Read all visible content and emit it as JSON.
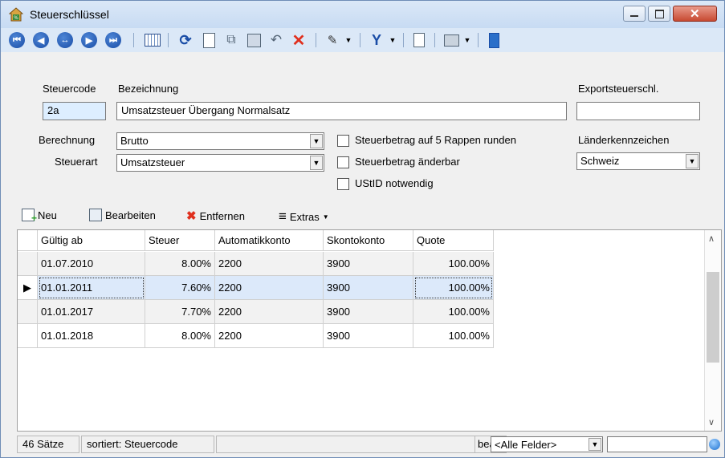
{
  "window": {
    "title": "Steuerschlüssel"
  },
  "titlebar": {
    "minimize": "minimize",
    "maximize": "maximize",
    "close": "close"
  },
  "toolbar": {
    "nav": [
      "first",
      "prev",
      "search",
      "next",
      "last"
    ],
    "icons": [
      "table-icon",
      "refresh-icon",
      "new-doc-icon",
      "copy-icon",
      "save-icon",
      "undo-icon",
      "delete-icon",
      "pin-icon",
      "filter-icon",
      "dataset-icon",
      "print-icon",
      "book-icon"
    ]
  },
  "form": {
    "steuercode_label": "Steuercode",
    "bezeichnung_label": "Bezeichnung",
    "export_label": "Exportsteuerschl.",
    "steuercode_value": "2a",
    "bezeichnung_value": "Umsatzsteuer Übergang Normalsatz",
    "export_value": "",
    "berechnung_label": "Berechnung",
    "berechnung_value": "Brutto",
    "steuerart_label": "Steuerart",
    "steuerart_value": "Umsatzsteuer",
    "cb_round": "Steuerbetrag auf 5 Rappen runden",
    "cb_edit": "Steuerbetrag änderbar",
    "cb_ustid": "UStID notwendig",
    "laender_label": "Länderkennzeichen",
    "laender_value": "Schweiz"
  },
  "subtoolbar": {
    "neu": "Neu",
    "bearbeiten": "Bearbeiten",
    "entfernen": "Entfernen",
    "extras": "Extras"
  },
  "grid": {
    "headers": [
      "Gültig ab",
      "Steuer",
      "Automatikkonto",
      "Skontokonto",
      "Quote"
    ],
    "rows": [
      {
        "date": "01.07.2010",
        "steuer": "8.00%",
        "auto": "2200",
        "skonto": "3900",
        "quote": "100.00%"
      },
      {
        "date": "01.01.2011",
        "steuer": "7.60%",
        "auto": "2200",
        "skonto": "3900",
        "quote": "100.00%"
      },
      {
        "date": "01.01.2017",
        "steuer": "7.70%",
        "auto": "2200",
        "skonto": "3900",
        "quote": "100.00%"
      },
      {
        "date": "01.01.2018",
        "steuer": "8.00%",
        "auto": "2200",
        "skonto": "3900",
        "quote": "100.00%"
      }
    ]
  },
  "status": {
    "count": "46 Sätze",
    "sort": "sortiert: Steuercode",
    "mode": "bearb",
    "field": "<Alle Felder>"
  }
}
